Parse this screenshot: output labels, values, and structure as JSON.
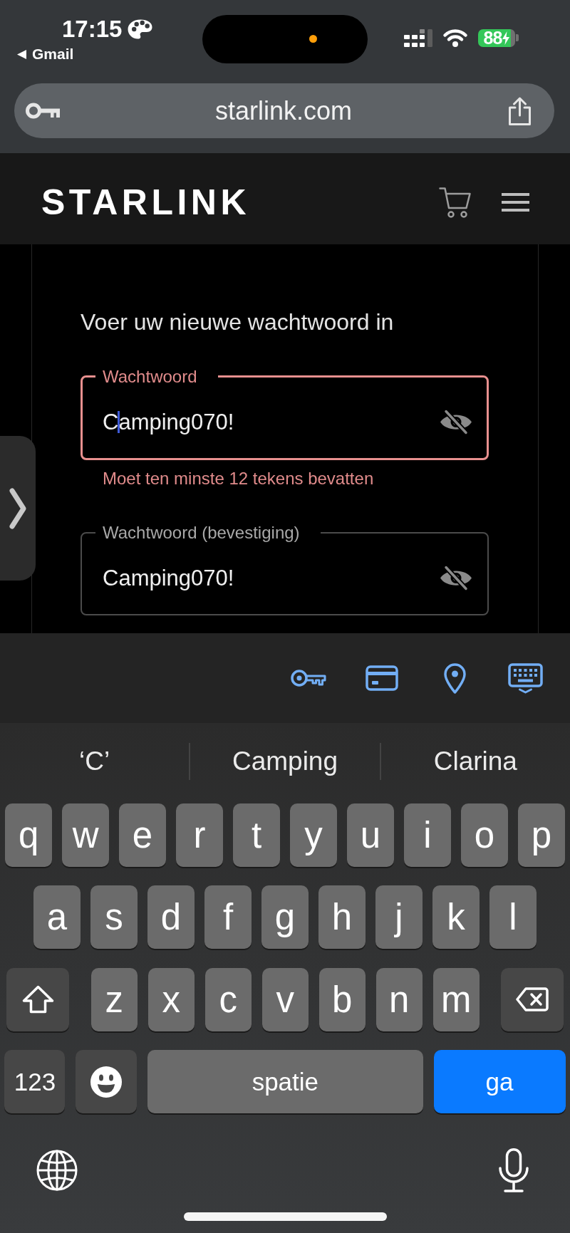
{
  "status_bar": {
    "time": "17:15",
    "back_app": "Gmail",
    "battery_percent": "88",
    "charging": true
  },
  "address_bar": {
    "url": "starlink.com"
  },
  "site_header": {
    "logo": "STARLINK"
  },
  "form": {
    "instruction": "Voer uw nieuwe wachtwoord in",
    "fields": [
      {
        "label": "Wachtwoord",
        "value": "Camping070!",
        "focused": true,
        "error": true,
        "error_message": "Moet ten minste 12 tekens bevatten"
      },
      {
        "label": "Wachtwoord (bevestiging)",
        "value": "Camping070!",
        "focused": false,
        "error": false
      }
    ]
  },
  "autofill_bar": {
    "buttons": [
      {
        "kind": "passwords"
      },
      {
        "kind": "cards"
      },
      {
        "kind": "location"
      },
      {
        "kind": "hide_keyboard"
      }
    ]
  },
  "keyboard": {
    "suggestions": [
      "‘C’",
      "Camping",
      "Clarina"
    ],
    "rows": [
      {
        "keys": [
          {
            "kind": "letter",
            "label": "q"
          },
          {
            "kind": "letter",
            "label": "w"
          },
          {
            "kind": "letter",
            "label": "e"
          },
          {
            "kind": "letter",
            "label": "r"
          },
          {
            "kind": "letter",
            "label": "t"
          },
          {
            "kind": "letter",
            "label": "y"
          },
          {
            "kind": "letter",
            "label": "u"
          },
          {
            "kind": "letter",
            "label": "i"
          },
          {
            "kind": "letter",
            "label": "o"
          },
          {
            "kind": "letter",
            "label": "p"
          }
        ]
      },
      {
        "keys": [
          {
            "kind": "letter",
            "label": "a"
          },
          {
            "kind": "letter",
            "label": "s"
          },
          {
            "kind": "letter",
            "label": "d"
          },
          {
            "kind": "letter",
            "label": "f"
          },
          {
            "kind": "letter",
            "label": "g"
          },
          {
            "kind": "letter",
            "label": "h"
          },
          {
            "kind": "letter",
            "label": "j"
          },
          {
            "kind": "letter",
            "label": "k"
          },
          {
            "kind": "letter",
            "label": "l"
          }
        ]
      },
      {
        "keys": [
          {
            "kind": "shift",
            "on": false
          },
          {
            "kind": "letter",
            "label": "z"
          },
          {
            "kind": "letter",
            "label": "x"
          },
          {
            "kind": "letter",
            "label": "c"
          },
          {
            "kind": "letter",
            "label": "v"
          },
          {
            "kind": "letter",
            "label": "b"
          },
          {
            "kind": "letter",
            "label": "n"
          },
          {
            "kind": "letter",
            "label": "m"
          },
          {
            "kind": "backspace"
          }
        ]
      },
      {
        "keys": [
          {
            "kind": "mode",
            "label": "123"
          },
          {
            "kind": "emoji"
          },
          {
            "kind": "space",
            "label": "spatie"
          },
          {
            "kind": "return",
            "label": "ga"
          }
        ]
      }
    ],
    "bottom": [
      {
        "kind": "globe"
      },
      {
        "kind": "dictation"
      }
    ]
  }
}
